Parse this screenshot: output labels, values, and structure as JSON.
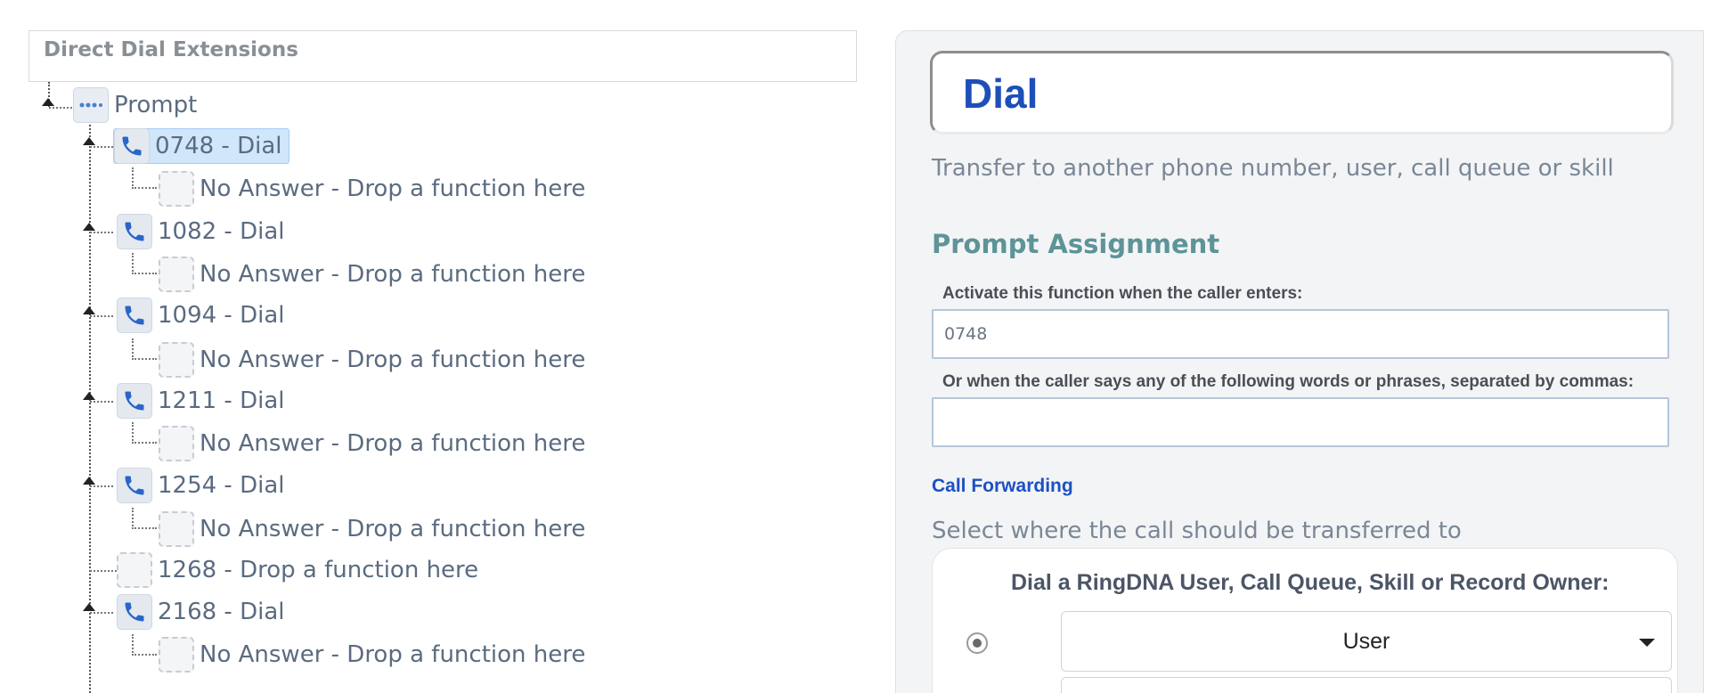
{
  "tree": {
    "header": "Direct Dial Extensions",
    "root": {
      "label": "Prompt",
      "icon": "prompt-icon"
    },
    "nodes": [
      {
        "label": "0748 - Dial",
        "icon": "phone-icon",
        "selected": true,
        "child": {
          "label": "No Answer - Drop a function here",
          "icon": "empty-slot-icon"
        }
      },
      {
        "label": "1082 - Dial",
        "icon": "phone-icon",
        "child": {
          "label": "No Answer - Drop a function here",
          "icon": "empty-slot-icon"
        }
      },
      {
        "label": "1094 - Dial",
        "icon": "phone-icon",
        "child": {
          "label": "No Answer - Drop a function here",
          "icon": "empty-slot-icon"
        }
      },
      {
        "label": "1211 - Dial",
        "icon": "phone-icon",
        "child": {
          "label": "No Answer - Drop a function here",
          "icon": "empty-slot-icon"
        }
      },
      {
        "label": "1254 - Dial",
        "icon": "phone-icon",
        "child": {
          "label": "No Answer - Drop a function here",
          "icon": "empty-slot-icon"
        }
      },
      {
        "label": "1268 - Drop a function here",
        "icon": "empty-slot-icon"
      },
      {
        "label": "2168 - Dial",
        "icon": "phone-icon",
        "child": {
          "label": "No Answer - Drop a function here",
          "icon": "empty-slot-icon"
        }
      }
    ]
  },
  "panel": {
    "title": "Dial",
    "description": "Transfer to another phone number, user, call queue or skill",
    "prompt_assignment": {
      "heading": "Prompt Assignment",
      "digits_label": "Activate this function when the caller enters:",
      "digits_value": "0748",
      "phrases_label": "Or when the caller says any of the following words or phrases, separated by commas:",
      "phrases_value": ""
    },
    "call_forwarding": {
      "heading": "Call Forwarding",
      "prompt": "Select where the call should be transferred to",
      "option_title": "Dial a RingDNA User, Call Queue, Skill or Record Owner:",
      "option_selected": true,
      "select_value": "User"
    }
  },
  "colors": {
    "title_blue": "#1d4fb8",
    "section_teal": "#5d9497",
    "selected_bg": "#cfe6fb",
    "phone_icon_blue": "#2a66c8"
  }
}
